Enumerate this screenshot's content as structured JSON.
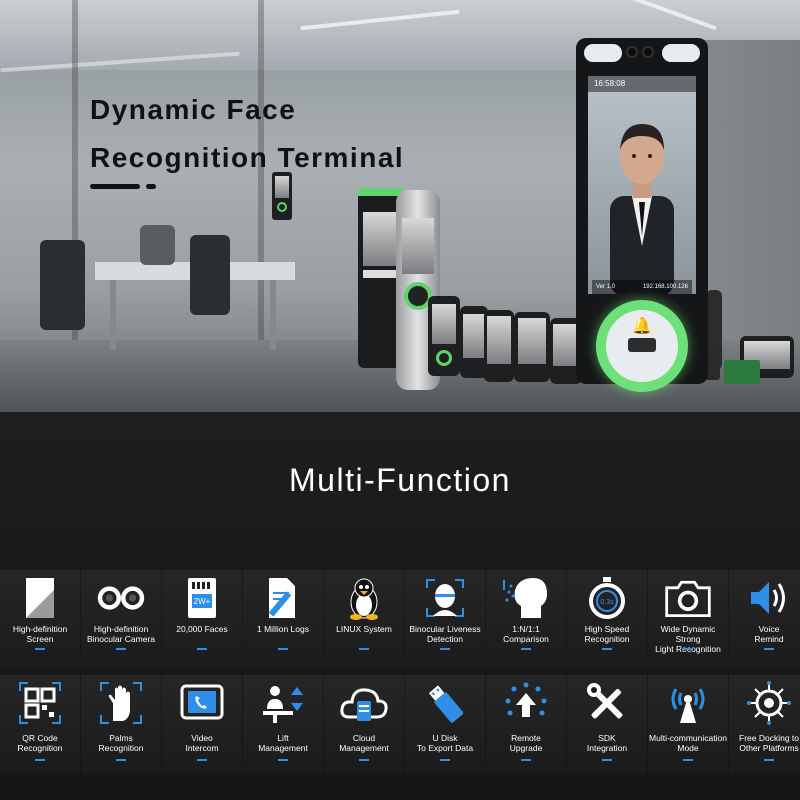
{
  "hero": {
    "title": "Dynamic Face\nRecognition Terminal",
    "device_clock": "16:58:08",
    "device_status_left": "Ver 1.0",
    "device_status_right": "192.168.100.126"
  },
  "section": {
    "title": "Multi-Function"
  },
  "colors": {
    "accent_blue": "#2f8fe8",
    "accent_green": "#5fd46b",
    "tile_background": "#232323"
  },
  "features_row1": [
    {
      "icon": "screen-icon",
      "label": "High-definition\nScreen"
    },
    {
      "icon": "binocular-camera-icon",
      "label": "High-definition\nBinocular Camera"
    },
    {
      "icon": "memory-card-icon",
      "label": "20,000 Faces",
      "badge": "2W+"
    },
    {
      "icon": "document-pen-icon",
      "label": "1 Million Logs"
    },
    {
      "icon": "linux-penguin-icon",
      "label": "LINUX System"
    },
    {
      "icon": "face-scan-icon",
      "label": "Binocular Liveness\nDetection"
    },
    {
      "icon": "head-profile-icon",
      "label": "1:N/1:1\nComparison"
    },
    {
      "icon": "stopwatch-icon",
      "label": "High Speed\nRecognition",
      "badge": "0.3s"
    },
    {
      "icon": "camera-icon",
      "label": "Wide Dynamic Strong\nLight Recognition"
    },
    {
      "icon": "speaker-icon",
      "label": "Voice\nRemind"
    }
  ],
  "features_row2": [
    {
      "icon": "qr-code-icon",
      "label": "QR Code\nRecognition"
    },
    {
      "icon": "palm-icon",
      "label": "Palms\nRecognition"
    },
    {
      "icon": "video-intercom-icon",
      "label": "Video\nIntercom"
    },
    {
      "icon": "lift-icon",
      "label": "Lift\nManagement"
    },
    {
      "icon": "cloud-icon",
      "label": "Cloud\nManagement"
    },
    {
      "icon": "usb-disk-icon",
      "label": "U Disk\nTo Export Data"
    },
    {
      "icon": "remote-upgrade-icon",
      "label": "Remote\nUpgrade"
    },
    {
      "icon": "tools-icon",
      "label": "SDK\nIntegration"
    },
    {
      "icon": "antenna-icon",
      "label": "Multi-communication\nMode"
    },
    {
      "icon": "docking-icon",
      "label": "Free Docking to\nOther Platforms"
    }
  ]
}
